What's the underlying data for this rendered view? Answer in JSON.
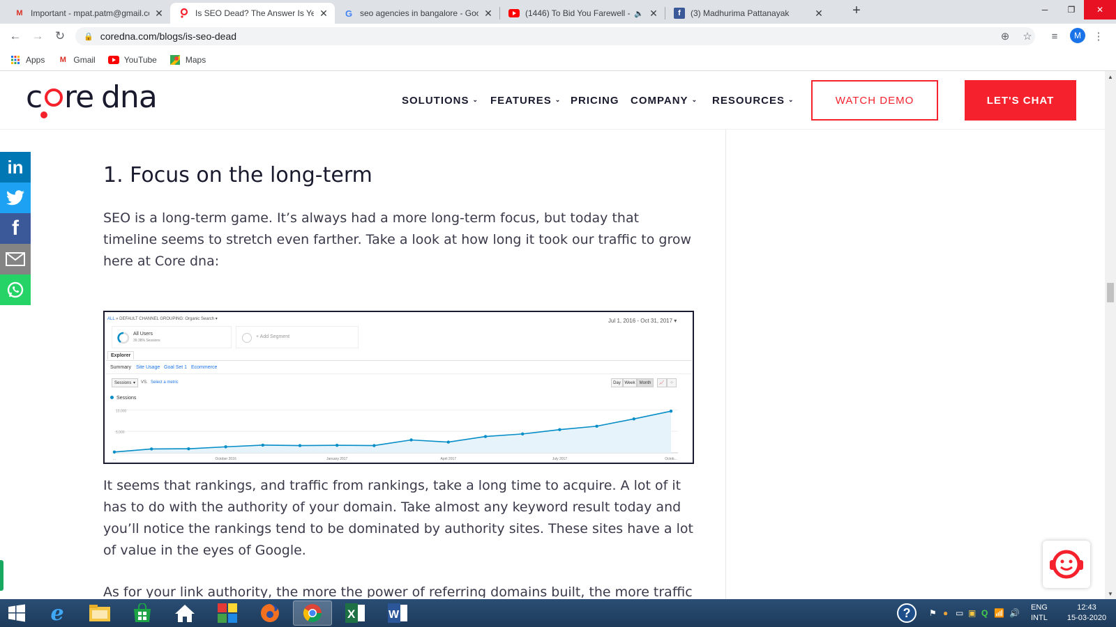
{
  "browser": {
    "tabs": [
      {
        "title": "Important - mpat.patm@gmail.com",
        "favicon": "gmail-icon",
        "active": false
      },
      {
        "title": "Is SEO Dead? The Answer Is Yes,",
        "favicon": "coredna-icon",
        "active": true
      },
      {
        "title": "seo agencies in bangalore - Goo",
        "favicon": "google-icon",
        "active": false
      },
      {
        "title": "(1446) To Bid You Farewell -",
        "favicon": "youtube-icon",
        "active": false
      },
      {
        "title": "(3) Madhurima Pattanayak",
        "favicon": "facebook-icon",
        "active": false
      }
    ],
    "url": "coredna.com/blogs/is-seo-dead",
    "avatar_letter": "M",
    "bookmarks": [
      {
        "label": "Apps",
        "icon": "apps-grid-icon"
      },
      {
        "label": "Gmail",
        "icon": "gmail-icon"
      },
      {
        "label": "YouTube",
        "icon": "youtube-icon"
      },
      {
        "label": "Maps",
        "icon": "maps-icon"
      }
    ]
  },
  "site": {
    "logo_text": "core dna",
    "nav": [
      {
        "label": "SOLUTIONS",
        "dropdown": true
      },
      {
        "label": "FEATURES",
        "dropdown": true
      },
      {
        "label": "PRICING",
        "dropdown": false
      },
      {
        "label": "COMPANY",
        "dropdown": true
      },
      {
        "label": "RESOURCES",
        "dropdown": true
      }
    ],
    "watch_demo": "WATCH DEMO",
    "lets_chat": "LET'S CHAT",
    "accent": "#f5222d"
  },
  "share": [
    {
      "icon": "linkedin-icon",
      "color": "#0077b5",
      "label": "in"
    },
    {
      "icon": "twitter-icon",
      "color": "#1da1f2",
      "label": "🐦"
    },
    {
      "icon": "facebook-icon",
      "color": "#3b5998",
      "label": "f"
    },
    {
      "icon": "email-icon",
      "color": "#848484",
      "label": "✉"
    },
    {
      "icon": "whatsapp-icon",
      "color": "#25d366",
      "label": "✆"
    }
  ],
  "article": {
    "heading": "1. Focus on the long-term",
    "para1": "SEO is a long-term game. It’s always had a more long-term focus, but today that timeline seems to stretch even farther. Take a look at how long it took our traffic to grow here at Core dna:",
    "para2": "It seems that rankings, and traffic from rankings, take a long time to acquire. A lot of it has to do with the authority of your domain. Take almost any keyword result today and you’ll notice the rankings tend to be dominated by authority sites. These sites have a lot of value in the eyes of Google.",
    "para3_partial": "As for your link authority, the more the power of referring domains built, the more traffic"
  },
  "analytics": {
    "breadcrumb_all": "ALL",
    "breadcrumb_group": "» DEFAULT CHANNEL GROUPING: Organic Search",
    "date_range": "Jul 1, 2016 - Oct 31, 2017",
    "segment_name": "All Users",
    "segment_pct": "39.38% Sessions",
    "add_segment": "+ Add Segment",
    "explorer_tab": "Explorer",
    "subtabs": [
      "Summary",
      "Site Usage",
      "Goal Set 1",
      "Ecommerce"
    ],
    "metric_select": "Sessions",
    "vs_label": "VS.",
    "select_metric": "Select a metric",
    "period_buttons": [
      "Day",
      "Week",
      "Month"
    ],
    "legend": "Sessions",
    "y_ticks": [
      "10,000",
      "5,000"
    ],
    "x_labels": [
      "...",
      "October 2016",
      "January 2017",
      "April 2017",
      "July 2017",
      "Octob..."
    ],
    "series_color": "#058dc7"
  },
  "chart_data": {
    "type": "area",
    "x": [
      "Jul 2016",
      "Aug 2016",
      "Sep 2016",
      "Oct 2016",
      "Nov 2016",
      "Dec 2016",
      "Jan 2017",
      "Feb 2017",
      "Mar 2017",
      "Apr 2017",
      "May 2017",
      "Jun 2017",
      "Jul 2017",
      "Aug 2017",
      "Sep 2017",
      "Oct 2017"
    ],
    "series": [
      {
        "name": "Sessions",
        "values": [
          200,
          900,
          950,
          1400,
          1800,
          1700,
          1750,
          1700,
          3000,
          2500,
          3800,
          4400,
          5400,
          6200,
          7900,
          9700
        ]
      }
    ],
    "ylim": [
      0,
      12000
    ],
    "y_ticks": [
      "10,000",
      "5,000"
    ],
    "legend": "top-left"
  },
  "taskbar": {
    "items": [
      {
        "icon": "windows-start-icon"
      },
      {
        "icon": "internet-explorer-icon"
      },
      {
        "icon": "file-explorer-icon"
      },
      {
        "icon": "store-icon"
      },
      {
        "icon": "home-icon"
      },
      {
        "icon": "puzzle-app-icon"
      },
      {
        "icon": "firefox-icon"
      },
      {
        "icon": "chrome-icon"
      },
      {
        "icon": "excel-icon"
      },
      {
        "icon": "word-icon"
      }
    ],
    "lang_top": "ENG",
    "lang_bottom": "INTL",
    "time": "12:43",
    "date": "15-03-2020"
  }
}
